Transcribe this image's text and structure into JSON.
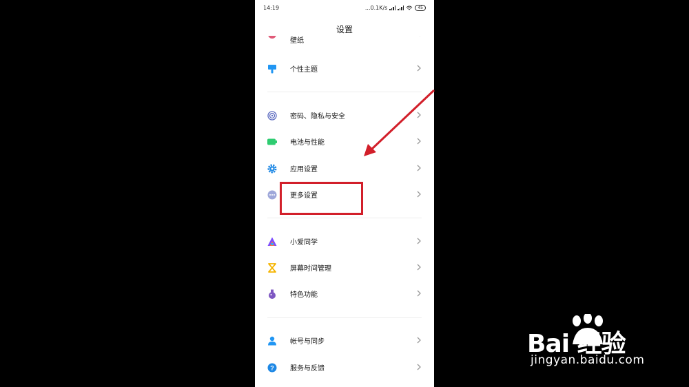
{
  "status_bar": {
    "time": "14:19",
    "speed": "...0.1K/s",
    "battery": "45"
  },
  "header": {
    "title": "设置"
  },
  "partial_item": {
    "label": "壁纸"
  },
  "groups": [
    [
      {
        "name": "theme",
        "label": "个性主题",
        "icon": "brush-icon",
        "color": "#2196f3"
      }
    ],
    [
      {
        "name": "security",
        "label": "密码、隐私与安全",
        "icon": "fingerprint-icon",
        "color": "#5c6bc0"
      },
      {
        "name": "battery",
        "label": "电池与性能",
        "icon": "battery-icon",
        "color": "#2ecc71"
      },
      {
        "name": "app-settings",
        "label": "应用设置",
        "icon": "gear-icon",
        "color": "#1e88e5"
      },
      {
        "name": "more-settings",
        "label": "更多设置",
        "icon": "more-dots-icon",
        "color": "#9fa8da"
      }
    ],
    [
      {
        "name": "xiaoai",
        "label": "小爱同学",
        "icon": "xiaoai-icon",
        "color": "#7c4dff"
      },
      {
        "name": "screen-time",
        "label": "屏幕时间管理",
        "icon": "hourglass-icon",
        "color": "#f5b400"
      },
      {
        "name": "special-features",
        "label": "特色功能",
        "icon": "flask-icon",
        "color": "#7e57c2"
      }
    ],
    [
      {
        "name": "account-sync",
        "label": "帐号与同步",
        "icon": "person-icon",
        "color": "#2196f3"
      },
      {
        "name": "feedback",
        "label": "服务与反馈",
        "icon": "help-icon",
        "color": "#1e88e5"
      }
    ]
  ],
  "annotation": {
    "highlight_color": "#d21f2a"
  },
  "watermark": {
    "brand": "Bai 经验",
    "url": "jingyan.baidu.com"
  }
}
